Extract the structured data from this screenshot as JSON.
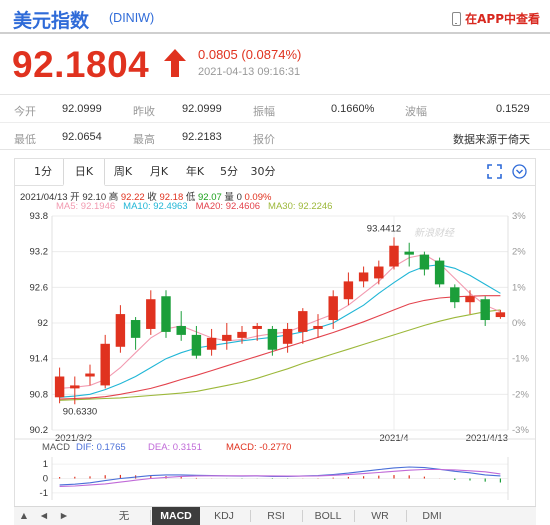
{
  "header": {
    "title": "美元指数",
    "code": "(DINIW)",
    "app_link": "在APP中查看"
  },
  "quote": {
    "price": "92.1804",
    "change": "0.0805 (0.0874%)",
    "timestamp": "2021-04-13 09:16:31"
  },
  "stats": {
    "row1": [
      {
        "label": "今开",
        "value": "92.0999"
      },
      {
        "label": "昨收",
        "value": "92.0999"
      },
      {
        "label": "振幅",
        "value": "0.1660%"
      },
      {
        "label": "波幅",
        "value": "0.1529"
      }
    ],
    "row2": [
      {
        "label": "最低",
        "value": "92.0654"
      },
      {
        "label": "最高",
        "value": "92.2183"
      },
      {
        "label": "报价",
        "value": "数据来源于倚天"
      }
    ]
  },
  "tabs": [
    "1分",
    "日K",
    "周K",
    "月K",
    "年K",
    "5分",
    "30分"
  ],
  "active_tab": "日K",
  "legend": {
    "line1": [
      {
        "text": "2021/04/13  开 92.10  高 ",
        "cls": ""
      },
      {
        "text": "92.22",
        "cls": "r"
      },
      {
        "text": "  收 ",
        "cls": ""
      },
      {
        "text": "92.18",
        "cls": "r"
      },
      {
        "text": "  低 ",
        "cls": ""
      },
      {
        "text": "92.07",
        "cls": "g"
      },
      {
        "text": "  量 0  ",
        "cls": ""
      },
      {
        "text": "0.09%",
        "cls": "r"
      }
    ],
    "ma": [
      {
        "label": "MA5: 92.1946",
        "color": "#f29ab0"
      },
      {
        "label": "MA10: 92.4963",
        "color": "#20b6d6"
      },
      {
        "label": "MA20: 92.4606",
        "color": "#e3434d"
      },
      {
        "label": "MA30: 92.2246",
        "color": "#9cb83a"
      }
    ]
  },
  "watermark": "新浪财经",
  "macd_legend": [
    {
      "label": "MACD",
      "color": "#555"
    },
    {
      "label": "DIF: 0.1765",
      "color": "#4a6fd8"
    },
    {
      "label": "DEA: 0.3151",
      "color": "#c06ad8"
    },
    {
      "label": "MACD: -0.2770",
      "color": "#e0321f"
    }
  ],
  "bottom_tabs": [
    "无",
    "MACD",
    "KDJ",
    "RSI",
    "BOLL",
    "WR",
    "DMI"
  ],
  "bottom_active": "MACD",
  "chart_data": {
    "type": "candlestick",
    "y_ticks_left": [
      "93.8",
      "93.2",
      "92.6",
      "92",
      "91.4",
      "90.8",
      "90.2"
    ],
    "y_ticks_right": [
      "3%",
      "2%",
      "1%",
      "0%",
      "-1%",
      "-2%",
      "-3%"
    ],
    "ylim": [
      90.2,
      93.8
    ],
    "x_labels": [
      {
        "idx": 0,
        "text": "2021/3/2"
      },
      {
        "idx": 22,
        "text": "2021/4"
      },
      {
        "idx": 29,
        "text": "2021/4/13"
      }
    ],
    "annotations": [
      {
        "idx": 21,
        "price": 93.4412,
        "text": "93.4412"
      },
      {
        "idx": 1,
        "price": 90.633,
        "text": "90.6330"
      }
    ],
    "candles": [
      {
        "o": 90.75,
        "c": 91.1,
        "h": 91.25,
        "l": 90.65
      },
      {
        "o": 90.9,
        "c": 90.95,
        "h": 91.1,
        "l": 90.633
      },
      {
        "o": 91.1,
        "c": 91.15,
        "h": 91.3,
        "l": 90.95
      },
      {
        "o": 90.95,
        "c": 91.65,
        "h": 91.8,
        "l": 90.9
      },
      {
        "o": 91.6,
        "c": 92.15,
        "h": 92.3,
        "l": 91.5
      },
      {
        "o": 92.05,
        "c": 91.75,
        "h": 92.1,
        "l": 91.55
      },
      {
        "o": 91.9,
        "c": 92.4,
        "h": 92.55,
        "l": 91.8
      },
      {
        "o": 92.45,
        "c": 91.85,
        "h": 92.55,
        "l": 91.75
      },
      {
        "o": 91.95,
        "c": 91.8,
        "h": 92.2,
        "l": 91.7
      },
      {
        "o": 91.8,
        "c": 91.45,
        "h": 91.95,
        "l": 91.4
      },
      {
        "o": 91.55,
        "c": 91.75,
        "h": 91.9,
        "l": 91.45
      },
      {
        "o": 91.7,
        "c": 91.8,
        "h": 92.0,
        "l": 91.55
      },
      {
        "o": 91.75,
        "c": 91.85,
        "h": 91.95,
        "l": 91.65
      },
      {
        "o": 91.9,
        "c": 91.95,
        "h": 92.0,
        "l": 91.7
      },
      {
        "o": 91.9,
        "c": 91.55,
        "h": 91.95,
        "l": 91.45
      },
      {
        "o": 91.65,
        "c": 91.9,
        "h": 92.0,
        "l": 91.5
      },
      {
        "o": 91.85,
        "c": 92.2,
        "h": 92.25,
        "l": 91.65
      },
      {
        "o": 91.9,
        "c": 91.95,
        "h": 92.15,
        "l": 91.75
      },
      {
        "o": 92.05,
        "c": 92.45,
        "h": 92.55,
        "l": 91.9
      },
      {
        "o": 92.4,
        "c": 92.7,
        "h": 92.85,
        "l": 92.3
      },
      {
        "o": 92.7,
        "c": 92.85,
        "h": 92.95,
        "l": 92.6
      },
      {
        "o": 92.75,
        "c": 92.95,
        "h": 93.05,
        "l": 92.65
      },
      {
        "o": 92.95,
        "c": 93.3,
        "h": 93.4412,
        "l": 92.9
      },
      {
        "o": 93.2,
        "c": 93.15,
        "h": 93.35,
        "l": 92.95
      },
      {
        "o": 93.15,
        "c": 92.9,
        "h": 93.2,
        "l": 92.8
      },
      {
        "o": 93.05,
        "c": 92.65,
        "h": 93.1,
        "l": 92.6
      },
      {
        "o": 92.6,
        "c": 92.35,
        "h": 92.65,
        "l": 92.25
      },
      {
        "o": 92.35,
        "c": 92.45,
        "h": 92.55,
        "l": 92.15
      },
      {
        "o": 92.4,
        "c": 92.05,
        "h": 92.45,
        "l": 91.95
      },
      {
        "o": 92.1,
        "c": 92.18,
        "h": 92.22,
        "l": 92.07
      }
    ],
    "ma5": [
      90.9,
      90.92,
      90.95,
      91.05,
      91.25,
      91.5,
      91.75,
      91.9,
      91.95,
      91.85,
      91.75,
      91.7,
      91.72,
      91.78,
      91.82,
      91.85,
      91.95,
      92.05,
      92.15,
      92.3,
      92.5,
      92.7,
      92.95,
      93.1,
      93.15,
      93.0,
      92.75,
      92.5,
      92.3,
      92.19
    ],
    "ma10": [
      90.75,
      90.77,
      90.8,
      90.88,
      90.98,
      91.1,
      91.25,
      91.4,
      91.5,
      91.58,
      91.62,
      91.66,
      91.7,
      91.73,
      91.76,
      91.8,
      91.85,
      91.92,
      92.0,
      92.15,
      92.3,
      92.5,
      92.68,
      92.85,
      92.95,
      92.98,
      92.92,
      92.8,
      92.65,
      92.5
    ],
    "ma20": [
      90.72,
      90.73,
      90.74,
      90.76,
      90.8,
      90.85,
      90.9,
      90.97,
      91.05,
      91.12,
      91.2,
      91.28,
      91.36,
      91.44,
      91.52,
      91.6,
      91.68,
      91.76,
      91.84,
      91.93,
      92.02,
      92.12,
      92.22,
      92.32,
      92.38,
      92.42,
      92.44,
      92.45,
      92.46,
      92.46
    ],
    "ma30": [
      90.7,
      90.71,
      90.72,
      90.73,
      90.74,
      90.76,
      90.78,
      90.8,
      90.82,
      90.85,
      90.9,
      90.95,
      91.0,
      91.07,
      91.15,
      91.23,
      91.32,
      91.4,
      91.48,
      91.56,
      91.64,
      91.72,
      91.8,
      91.88,
      91.96,
      92.03,
      92.09,
      92.14,
      92.19,
      92.22
    ],
    "macd_ticks": [
      "1",
      "0",
      "-1"
    ],
    "macd_ylim": [
      -1.5,
      1.5
    ],
    "dif": [
      -0.45,
      -0.4,
      -0.3,
      -0.15,
      0.0,
      0.1,
      0.2,
      0.25,
      0.25,
      0.22,
      0.2,
      0.18,
      0.17,
      0.18,
      0.15,
      0.15,
      0.18,
      0.2,
      0.28,
      0.38,
      0.5,
      0.62,
      0.74,
      0.8,
      0.76,
      0.64,
      0.5,
      0.4,
      0.25,
      0.18
    ],
    "dea": [
      -0.55,
      -0.52,
      -0.45,
      -0.38,
      -0.25,
      -0.12,
      0.0,
      0.08,
      0.15,
      0.18,
      0.19,
      0.19,
      0.19,
      0.19,
      0.18,
      0.17,
      0.17,
      0.18,
      0.22,
      0.27,
      0.34,
      0.42,
      0.5,
      0.58,
      0.63,
      0.63,
      0.6,
      0.54,
      0.47,
      0.32
    ],
    "hist": [
      0.1,
      0.12,
      0.15,
      0.23,
      0.25,
      0.22,
      0.2,
      0.17,
      0.1,
      0.04,
      0.01,
      -0.01,
      -0.02,
      -0.01,
      -0.03,
      -0.02,
      0.01,
      0.02,
      0.06,
      0.11,
      0.16,
      0.2,
      0.24,
      0.22,
      0.13,
      0.01,
      -0.1,
      -0.14,
      -0.22,
      -0.28
    ]
  }
}
